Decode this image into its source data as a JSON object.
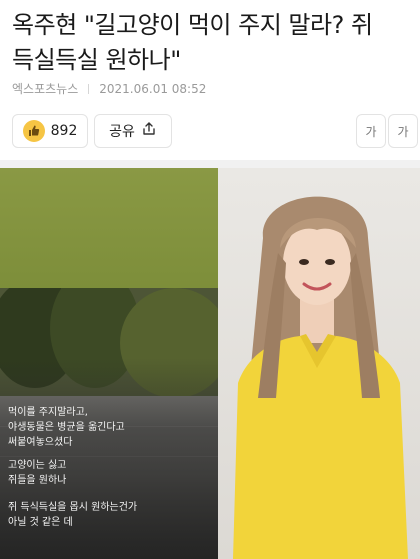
{
  "article": {
    "title_line1": "옥주현 \"길고양이 먹이 주지 말라? 쥐",
    "title_line2": "득실득실 원하나\"",
    "source": "엑스포츠뉴스",
    "datetime": "2021.06.01 08:52"
  },
  "actions": {
    "like_count": "892",
    "share_label": "공유",
    "font_small_label": "가",
    "font_large_label": "가"
  },
  "photo": {
    "caption_lines": [
      "먹이를 주지말라고,",
      "야생동물은 병균을 옮긴다고",
      "써붙여놓으셨다",
      "고양이는 싫고",
      "쥐들을 원하나",
      "쥐 득식득실을 몹시 원하는건가",
      "아닐 것 같은 데"
    ]
  },
  "colors": {
    "accent_like": "#f6c544",
    "shirt": "#f2d43a",
    "left_panel": "#7a8a3c"
  }
}
